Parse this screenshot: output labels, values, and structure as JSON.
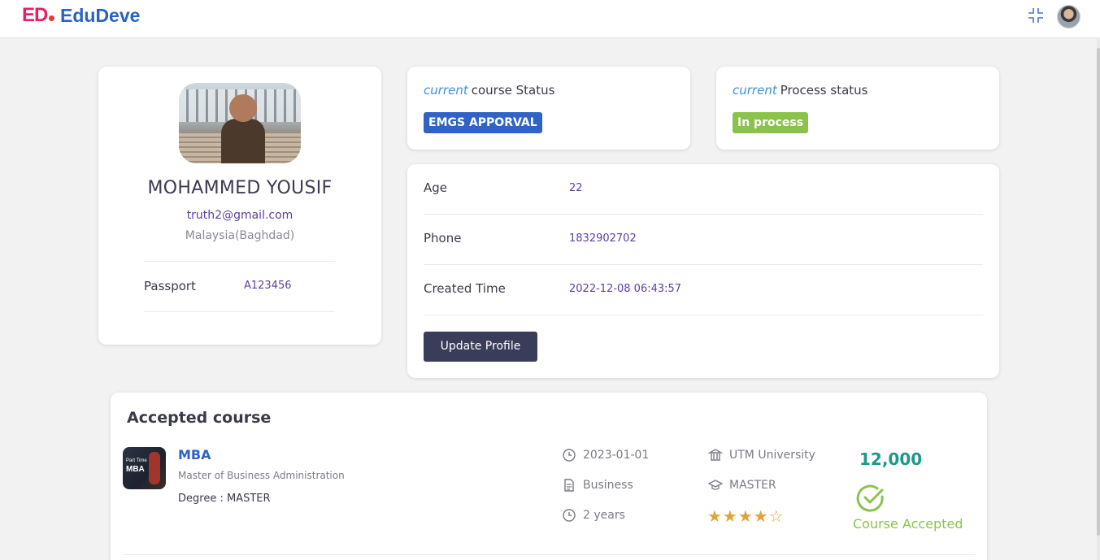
{
  "header": {
    "logo_mark": "ED",
    "brand": "EduDeve"
  },
  "profile": {
    "name": "MOHAMMED YOUSIF",
    "email": "truth2@gmail.com",
    "location": "Malaysia(Baghdad)",
    "passport_label": "Passport",
    "passport_value": "A123456"
  },
  "course_status": {
    "prefix": "current",
    "title": "course Status",
    "badge": "EMGS APPORVAL",
    "badge_color": "#2f63c7"
  },
  "process_status": {
    "prefix": "current",
    "title": "Process status",
    "badge": "In process",
    "badge_color": "#8bc34a"
  },
  "info": {
    "age_label": "Age",
    "age_value": "22",
    "phone_label": "Phone",
    "phone_value": "1832902702",
    "created_label": "Created Time",
    "created_value": "2022-12-08 06:43:57",
    "update_button": "Update Profile"
  },
  "accepted_course": {
    "section_title": "Accepted course",
    "thumbnail_line1": "Part Time",
    "thumbnail_line2": "MBA",
    "name": "MBA",
    "full_name": "Master of Business Administration",
    "degree": "Degree : MASTER",
    "start_date": "2023-01-01",
    "category": "Business",
    "duration": "2 years",
    "university": "UTM University",
    "level": "MASTER",
    "rating": 4,
    "rating_max": 5,
    "stars_text": "★★★★☆",
    "price": "12,000",
    "status": "Course Accepted"
  }
}
